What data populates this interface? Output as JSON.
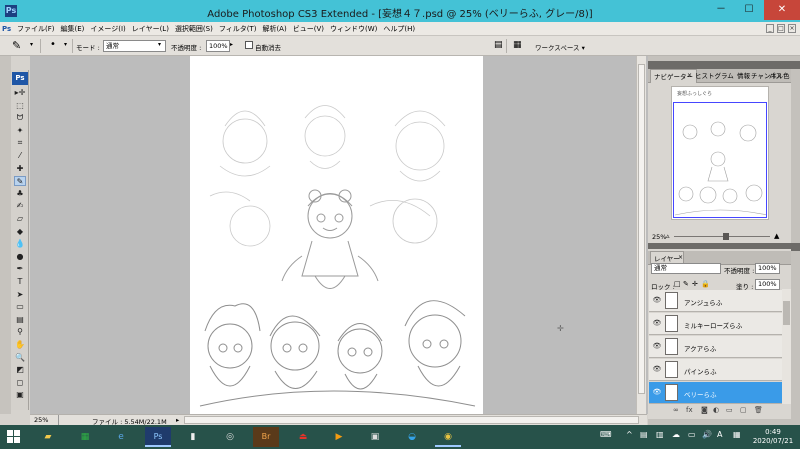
{
  "app": {
    "window_title": "Adobe Photoshop CS3 Extended - [妄想４７.psd @ 25% (ベリーらふ, グレー/8)]",
    "window_controls": [
      "－",
      "☐",
      "✕"
    ]
  },
  "menu": {
    "items": [
      "ファイル(F)",
      "編集(E)",
      "イメージ(I)",
      "レイヤー(L)",
      "選択範囲(S)",
      "フィルタ(T)",
      "解析(A)",
      "ビュー(V)",
      "ウィンドウ(W)",
      "ヘルプ(H)"
    ],
    "doc_controls": [
      "_",
      "□",
      "×"
    ]
  },
  "options": {
    "mode_label": "モード :",
    "mode_value": "通常",
    "opacity_label": "不透明度 :",
    "opacity_value": "100%",
    "auto_erase_label": "自動消去",
    "workspace_label": "ワークスペース ▾"
  },
  "toolbox": {
    "logo": "Ps",
    "tools": [
      {
        "icon": "move-icon",
        "glyph": "▸✛"
      },
      {
        "icon": "marquee-icon",
        "glyph": "⬚"
      },
      {
        "icon": "lasso-icon",
        "glyph": "ᗢ"
      },
      {
        "icon": "magic-wand-icon",
        "glyph": "✦"
      },
      {
        "icon": "crop-icon",
        "glyph": "⌗"
      },
      {
        "icon": "slice-icon",
        "glyph": "⁄"
      },
      {
        "icon": "healing-brush-icon",
        "glyph": "✚"
      },
      {
        "icon": "pencil-icon",
        "glyph": "✎"
      },
      {
        "icon": "clone-stamp-icon",
        "glyph": "♣"
      },
      {
        "icon": "history-brush-icon",
        "glyph": "✍"
      },
      {
        "icon": "eraser-icon",
        "glyph": "▱"
      },
      {
        "icon": "paint-bucket-icon",
        "glyph": "◆"
      },
      {
        "icon": "blur-icon",
        "glyph": "💧"
      },
      {
        "icon": "dodge-icon",
        "glyph": "●"
      },
      {
        "icon": "pen-icon",
        "glyph": "✒"
      },
      {
        "icon": "type-icon",
        "glyph": "T"
      },
      {
        "icon": "path-selection-icon",
        "glyph": "➤"
      },
      {
        "icon": "shape-icon",
        "glyph": "▭"
      },
      {
        "icon": "notes-icon",
        "glyph": "▤"
      },
      {
        "icon": "eyedropper-icon",
        "glyph": "⚲"
      },
      {
        "icon": "hand-icon",
        "glyph": "✋"
      },
      {
        "icon": "zoom-icon",
        "glyph": "🔍"
      },
      {
        "icon": "color-swatches-icon",
        "glyph": "◩"
      },
      {
        "icon": "quick-mask-icon",
        "glyph": "◻"
      },
      {
        "icon": "screen-mode-icon",
        "glyph": "▣"
      }
    ]
  },
  "status": {
    "zoom": "25%",
    "file_info": "ファイル : 5.54M/22.1M"
  },
  "navigator": {
    "tabs": [
      "ナビゲーター",
      "ヒストグラム",
      "情報",
      "チャンネル",
      "パス",
      "色"
    ],
    "zoom": "25%",
    "thumb_text": "妄想ふっしぐら"
  },
  "layers_panel": {
    "tab": "レイヤー",
    "blend_mode": "通常",
    "opacity_label": "不透明度 :",
    "opacity_value": "100%",
    "lock_label": "ロック :",
    "fill_label": "塗り :",
    "fill_value": "100%",
    "layers": [
      {
        "name": "アンジュらふ",
        "selected": false
      },
      {
        "name": "ミルキーローズらふ",
        "selected": false
      },
      {
        "name": "アクアらふ",
        "selected": false
      },
      {
        "name": "パインらふ",
        "selected": false
      },
      {
        "name": "ベリーらふ",
        "selected": true
      }
    ]
  },
  "taskbar": {
    "clock_time": "0:49",
    "clock_date": "2020/07/21",
    "ime_label": "A"
  }
}
